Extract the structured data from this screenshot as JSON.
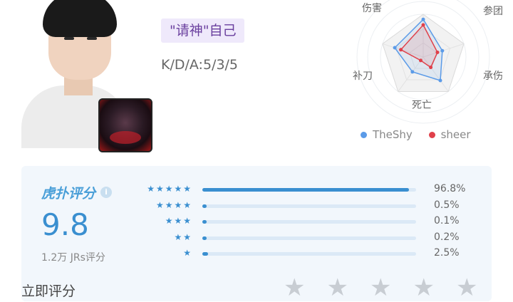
{
  "profile": {
    "tag_text": "\"请神\"自己",
    "kda_text": "K/D/A:5/3/5"
  },
  "radar": {
    "labels": [
      "伤害",
      "参团",
      "承伤",
      "死亡",
      "补刀"
    ],
    "series": [
      {
        "name": "TheShy",
        "color": "#5b9be8",
        "values": [
          0.88,
          0.47,
          0.68,
          0.43,
          0.7
        ]
      },
      {
        "name": "sheer",
        "color": "#e0404a",
        "values": [
          0.75,
          0.35,
          0.3,
          0.1,
          0.55
        ]
      }
    ]
  },
  "rating": {
    "brand": "虎扑评分",
    "score": "9.8",
    "raters": "1.2万 JRs评分",
    "distribution": [
      {
        "stars": "★★★★★",
        "fraction": 0.968,
        "pct": "96.8%"
      },
      {
        "stars": "★★★★",
        "fraction": 0.005,
        "pct": "0.5%"
      },
      {
        "stars": "★★★",
        "fraction": 0.001,
        "pct": "0.1%"
      },
      {
        "stars": "★★",
        "fraction": 0.002,
        "pct": "0.2%"
      },
      {
        "stars": "★",
        "fraction": 0.025,
        "pct": "2.5%"
      }
    ],
    "my_rating_label": "立即评分",
    "my_rating_stars": 0
  },
  "colors": {
    "accent": "#3a8fd0",
    "tag_bg": "#efe9fb",
    "tag_text": "#6a3f9e"
  }
}
